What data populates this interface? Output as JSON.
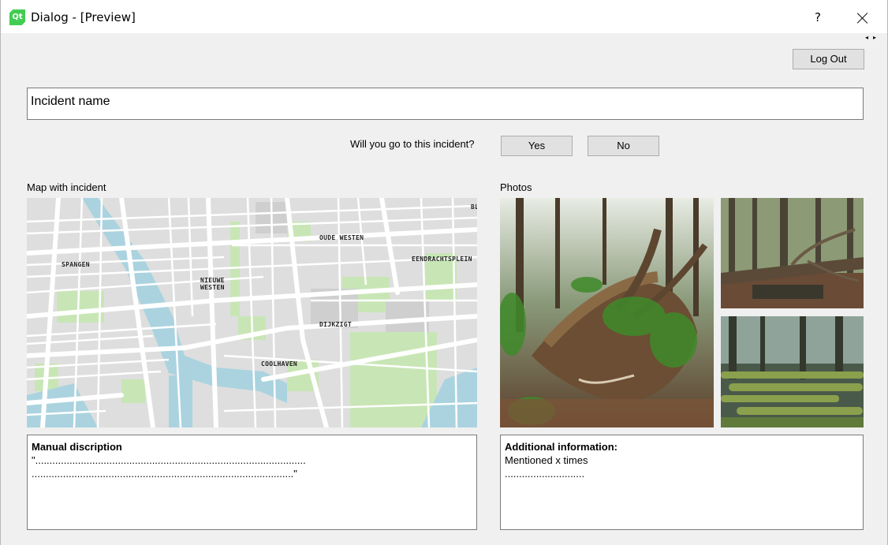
{
  "window": {
    "title": "Dialog - [Preview]",
    "help_label": "?",
    "scroll_arrows": "◂▸"
  },
  "header": {
    "logout_label": "Log Out"
  },
  "incident": {
    "name": "Incident name",
    "question": "Will you go to this incident?",
    "yes_label": "Yes",
    "no_label": "No"
  },
  "map": {
    "label": "Map with incident",
    "places": [
      "SPANGEN",
      "NIEUWE\nWESTEN",
      "OUDE WESTEN",
      "EENDRACHTSPLEIN",
      "DIJKZIGT",
      "COOLHAVEN",
      "BL"
    ]
  },
  "photos": {
    "label": "Photos"
  },
  "description": {
    "title": "Manual discription",
    "line1": "\"...............................................................................................",
    "line2": "............................................................................................\""
  },
  "info": {
    "title": "Additional information:",
    "line1": "Mentioned x times",
    "line2": "............................"
  },
  "colors": {
    "window_bg": "#f0f0f0",
    "button_bg": "#e1e1e1",
    "map_water": "#aad3df",
    "map_park": "#c8e6b5",
    "qt_green": "#41cd52"
  }
}
